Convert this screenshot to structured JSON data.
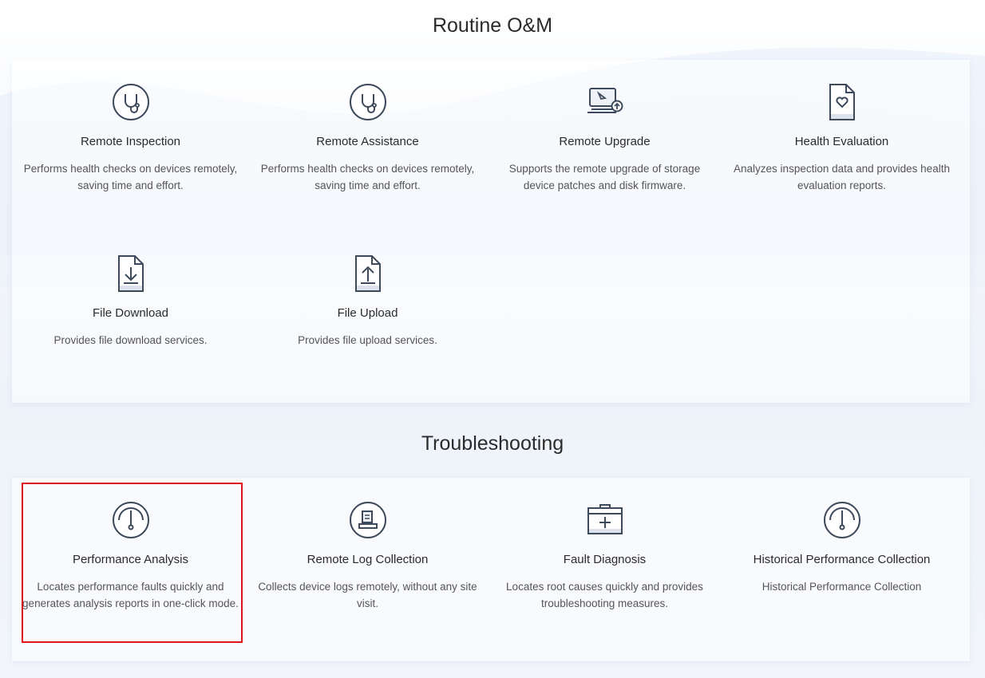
{
  "sections": {
    "routine": {
      "title": "Routine O&M",
      "cards": [
        {
          "name": "Remote Inspection",
          "desc": "Performs health checks on devices remotely, saving time and effort.",
          "icon": "stethoscope-icon"
        },
        {
          "name": "Remote Assistance",
          "desc": "Performs health checks on devices remotely, saving time and effort.",
          "icon": "stethoscope-icon"
        },
        {
          "name": "Remote Upgrade",
          "desc": "Supports the remote upgrade of storage device patches and disk firmware.",
          "icon": "laptop-upgrade-icon"
        },
        {
          "name": "Health Evaluation",
          "desc": "Analyzes inspection data and provides health evaluation reports.",
          "icon": "health-report-icon"
        },
        {
          "name": "File Download",
          "desc": "Provides file download services.",
          "icon": "file-download-icon"
        },
        {
          "name": "File Upload",
          "desc": "Provides file upload services.",
          "icon": "file-upload-icon"
        }
      ]
    },
    "troubleshooting": {
      "title": "Troubleshooting",
      "cards": [
        {
          "name": "Performance Analysis",
          "desc": "Locates performance faults quickly and generates analysis reports in one-click mode.",
          "icon": "gauge-icon"
        },
        {
          "name": "Remote Log Collection",
          "desc": "Collects device logs remotely, without any site visit.",
          "icon": "log-collection-icon"
        },
        {
          "name": "Fault Diagnosis",
          "desc": "Locates root causes quickly and provides troubleshooting measures.",
          "icon": "medical-kit-icon"
        },
        {
          "name": "Historical Performance Collection",
          "desc": "Historical Performance Collection",
          "icon": "gauge-icon"
        }
      ]
    }
  },
  "colors": {
    "icon_stroke": "#3d4a5c",
    "icon_fill": "#eef2f7",
    "highlight": "#e0141c"
  }
}
